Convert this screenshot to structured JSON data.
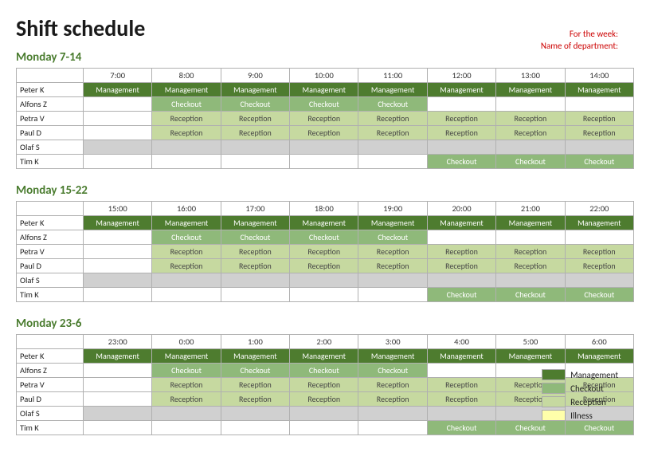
{
  "title": "Shift schedule",
  "weekInfo": {
    "label1": "For the week:",
    "label2": "Name of department:"
  },
  "sections": [
    {
      "id": "morning",
      "title": "Monday 7-14",
      "hours": [
        "7:00",
        "8:00",
        "9:00",
        "10:00",
        "11:00",
        "12:00",
        "13:00",
        "14:00"
      ],
      "rows": [
        {
          "name": "Peter K",
          "cells": [
            "management",
            "management",
            "management",
            "management",
            "management",
            "management",
            "management",
            "management"
          ]
        },
        {
          "name": "Alfons Z",
          "cells": [
            "empty",
            "checkout",
            "checkout",
            "checkout",
            "checkout",
            "empty",
            "empty",
            "empty"
          ]
        },
        {
          "name": "Petra V",
          "cells": [
            "empty",
            "reception",
            "reception",
            "reception",
            "reception",
            "reception",
            "reception",
            "reception"
          ]
        },
        {
          "name": "Paul D",
          "cells": [
            "empty",
            "reception",
            "reception",
            "reception",
            "reception",
            "reception",
            "reception",
            "reception"
          ]
        },
        {
          "name": "Olaf S",
          "cells": [
            "gray",
            "gray",
            "gray",
            "gray",
            "gray",
            "gray",
            "gray",
            "gray"
          ]
        },
        {
          "name": "Tim K",
          "cells": [
            "empty",
            "empty",
            "empty",
            "empty",
            "empty",
            "checkout",
            "checkout",
            "checkout"
          ]
        }
      ]
    },
    {
      "id": "afternoon",
      "title": "Monday 15-22",
      "hours": [
        "15:00",
        "16:00",
        "17:00",
        "18:00",
        "19:00",
        "20:00",
        "21:00",
        "22:00"
      ],
      "rows": [
        {
          "name": "Peter K",
          "cells": [
            "management",
            "management",
            "management",
            "management",
            "management",
            "management",
            "management",
            "management"
          ]
        },
        {
          "name": "Alfons Z",
          "cells": [
            "empty",
            "checkout",
            "checkout",
            "checkout",
            "checkout",
            "empty",
            "empty",
            "empty"
          ]
        },
        {
          "name": "Petra V",
          "cells": [
            "empty",
            "reception",
            "reception",
            "reception",
            "reception",
            "reception",
            "reception",
            "reception"
          ]
        },
        {
          "name": "Paul D",
          "cells": [
            "empty",
            "reception",
            "reception",
            "reception",
            "reception",
            "reception",
            "reception",
            "reception"
          ]
        },
        {
          "name": "Olaf S",
          "cells": [
            "gray",
            "gray",
            "gray",
            "gray",
            "gray",
            "gray",
            "gray",
            "gray"
          ]
        },
        {
          "name": "Tim K",
          "cells": [
            "empty",
            "empty",
            "empty",
            "empty",
            "empty",
            "checkout",
            "checkout",
            "checkout"
          ]
        }
      ]
    },
    {
      "id": "night",
      "title": "Monday 23-6",
      "hours": [
        "23:00",
        "0:00",
        "1:00",
        "2:00",
        "3:00",
        "4:00",
        "5:00",
        "6:00"
      ],
      "rows": [
        {
          "name": "Peter K",
          "cells": [
            "management",
            "management",
            "management",
            "management",
            "management",
            "management",
            "management",
            "management"
          ]
        },
        {
          "name": "Alfons Z",
          "cells": [
            "empty",
            "checkout",
            "checkout",
            "checkout",
            "checkout",
            "empty",
            "empty",
            "empty"
          ]
        },
        {
          "name": "Petra V",
          "cells": [
            "empty",
            "reception",
            "reception",
            "reception",
            "reception",
            "reception",
            "reception",
            "reception"
          ]
        },
        {
          "name": "Paul D",
          "cells": [
            "empty",
            "reception",
            "reception",
            "reception",
            "reception",
            "reception",
            "reception",
            "reception"
          ]
        },
        {
          "name": "Olaf S",
          "cells": [
            "gray",
            "gray",
            "gray",
            "gray",
            "gray",
            "gray",
            "gray",
            "gray"
          ]
        },
        {
          "name": "Tim K",
          "cells": [
            "empty",
            "empty",
            "empty",
            "empty",
            "empty",
            "checkout",
            "checkout",
            "checkout"
          ]
        }
      ]
    }
  ],
  "legend": [
    {
      "type": "management",
      "label": "Management"
    },
    {
      "type": "checkout",
      "label": "Checkout"
    },
    {
      "type": "reception",
      "label": "Reception"
    },
    {
      "type": "illness",
      "label": "Illness"
    }
  ],
  "cellLabels": {
    "management": "Management",
    "checkout": "Checkout",
    "reception": "Reception",
    "illness": "Illness",
    "empty": "",
    "gray": ""
  }
}
